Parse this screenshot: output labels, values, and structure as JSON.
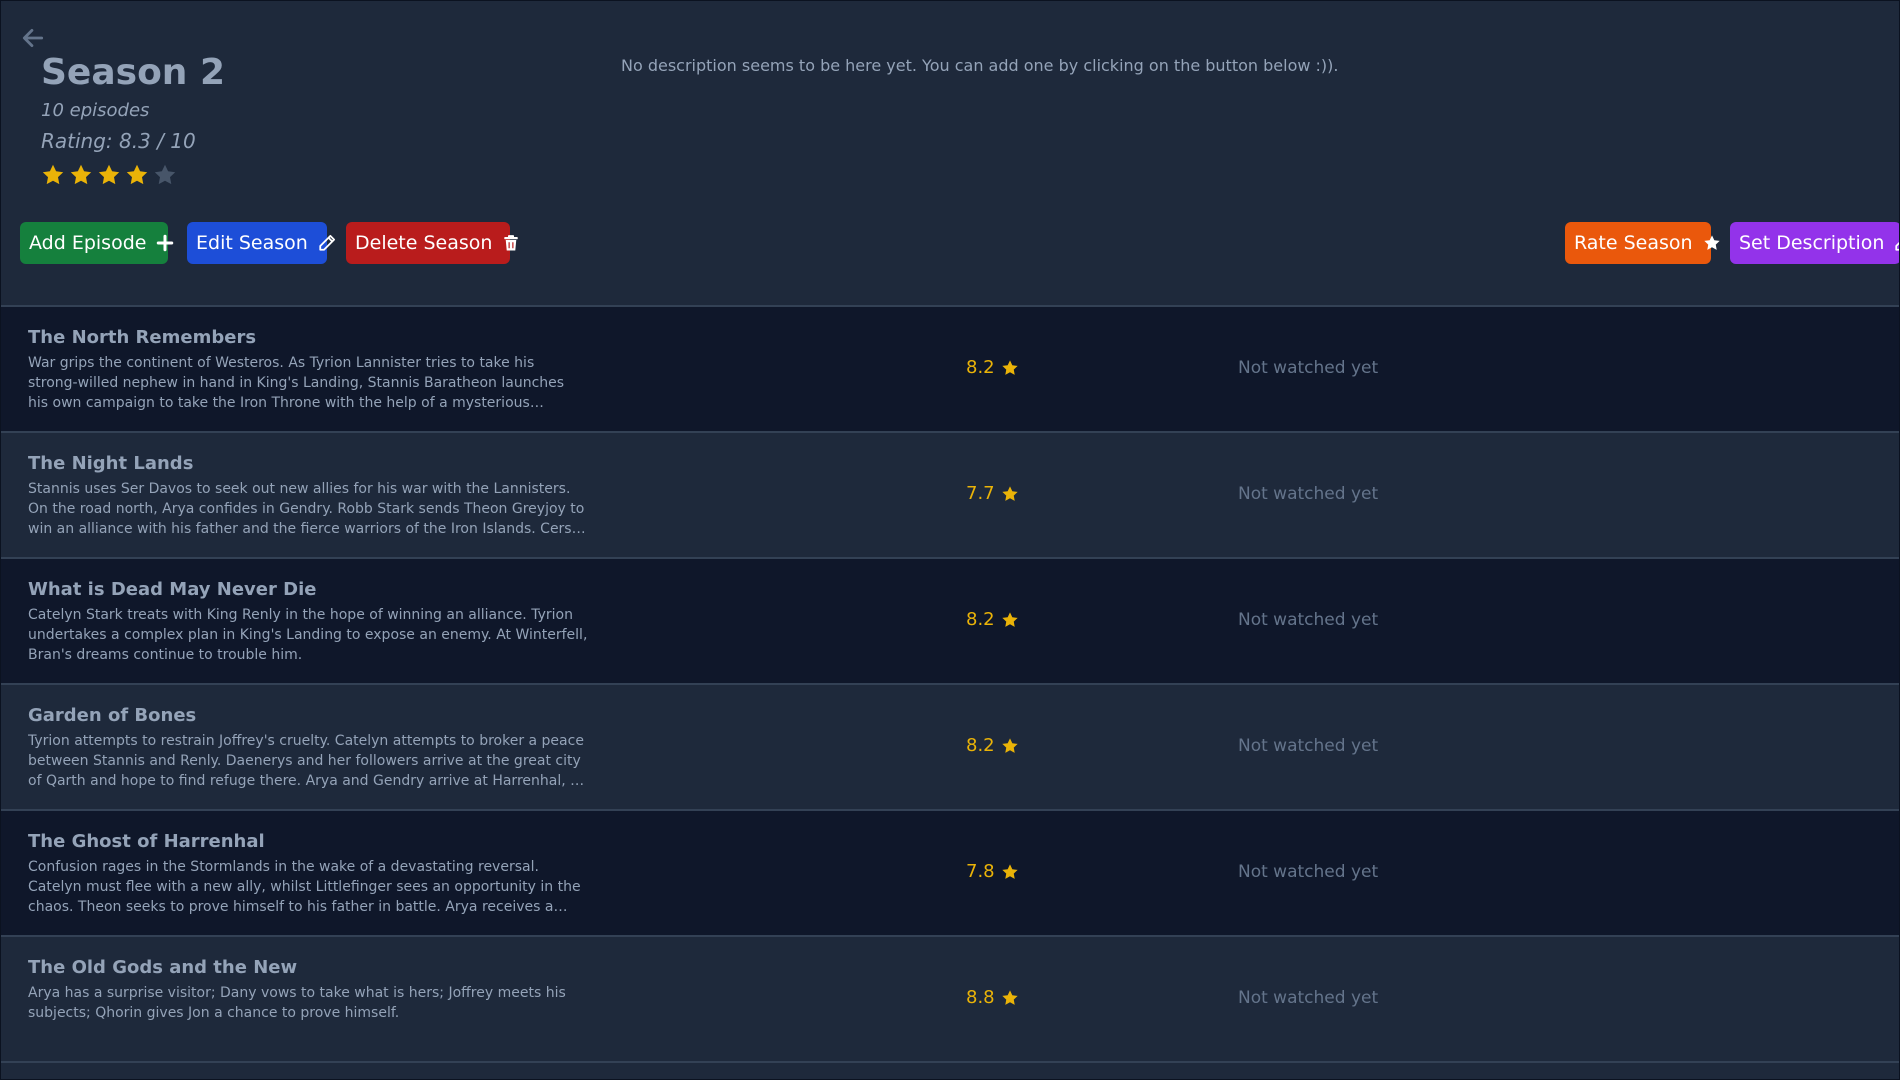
{
  "header": {
    "back_icon": "arrow-left-icon",
    "title": "Season 2",
    "episode_count": "10 episodes",
    "rating_text": "Rating: 8.3 / 10",
    "star_rating": {
      "filled": 4,
      "total": 5
    },
    "description": "No description seems to be here yet. You can add one by clicking on the button below :))."
  },
  "toolbar": {
    "add_episode": {
      "label": "Add Episode",
      "icon": "plus-icon",
      "color": "#15803d"
    },
    "edit_season": {
      "label": "Edit Season",
      "icon": "pencil-icon",
      "color": "#1d4ed8"
    },
    "delete_season": {
      "label": "Delete Season",
      "icon": "trash-icon",
      "color": "#b91c1c"
    },
    "rate_season": {
      "label": "Rate Season",
      "icon": "star-icon",
      "color": "#ea580c"
    },
    "set_description": {
      "label": "Set Description",
      "icon": "pencil-icon",
      "color": "#9333ea"
    }
  },
  "colors": {
    "background": "#1e293b",
    "row_dark": "#0f172a",
    "star_filled": "#eab308",
    "star_empty": "#475569",
    "text": "#94a3b8"
  },
  "episodes": [
    {
      "title": "The North Remembers",
      "description": "War grips the continent of Westeros. As Tyrion Lannister tries to take his strong-willed nephew in hand in King's Landing, Stannis Baratheon launches his own campaign to take the Iron Throne with the help of a mysterious priestess. In the...",
      "rating": "8.2",
      "status": "Not watched yet"
    },
    {
      "title": "The Night Lands",
      "description": "Stannis uses Ser Davos to seek out new allies for his war with the Lannisters. On the road north, Arya confides in Gendry. Robb Stark sends Theon Greyjoy to win an alliance with his father and the fierce warriors of the Iron Islands. Cersei and Tyrio...",
      "rating": "7.7",
      "status": "Not watched yet"
    },
    {
      "title": "What is Dead May Never Die",
      "description": "Catelyn Stark treats with King Renly in the hope of winning an alliance. Tyrion undertakes a complex plan in King's Landing to expose an enemy. At Winterfell, Bran's dreams continue to trouble him.",
      "rating": "8.2",
      "status": "Not watched yet"
    },
    {
      "title": "Garden of Bones",
      "description": "Tyrion attempts to restrain Joffrey's cruelty. Catelyn attempts to broker a peace between Stannis and Renly. Daenerys and her followers arrive at the great city of Qarth and hope to find refuge there. Arya and Gendry arrive at Harrenhal, a great...",
      "rating": "8.2",
      "status": "Not watched yet"
    },
    {
      "title": "The Ghost of Harrenhal",
      "description": "Confusion rages in the Stormlands in the wake of a devastating reversal. Catelyn must flee with a new ally, whilst Littlefinger sees an opportunity in the chaos. Theon seeks to prove himself to his father in battle. Arya receives a promise from the...",
      "rating": "7.8",
      "status": "Not watched yet"
    },
    {
      "title": "The Old Gods and the New",
      "description": "Arya has a surprise visitor; Dany vows to take what is hers; Joffrey meets his subjects; Qhorin gives Jon a chance to prove himself.",
      "rating": "8.8",
      "status": "Not watched yet"
    }
  ]
}
